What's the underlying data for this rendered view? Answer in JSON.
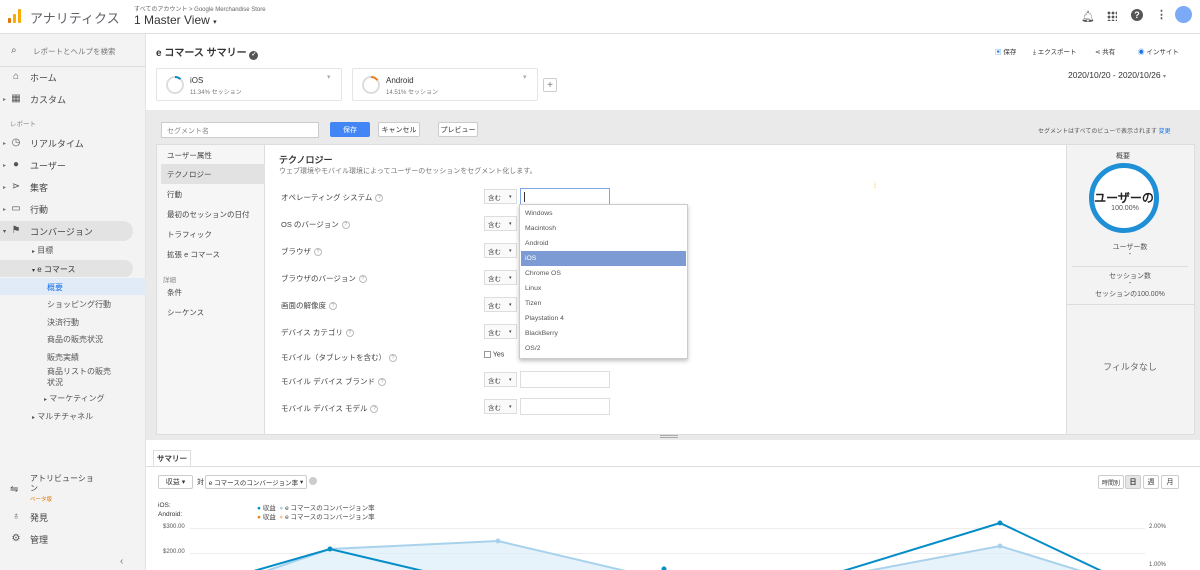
{
  "app": {
    "name": "アナリティクス",
    "breadcrumb": "すべてのアカウント > Google Merchandise Store",
    "view": "1 Master View"
  },
  "sidebar": {
    "search_placeholder": "レポートとヘルプを検索",
    "home": "ホーム",
    "custom": "カスタム",
    "reports_heading": "レポート",
    "realtime": "リアルタイム",
    "users": "ユーザー",
    "acquisition": "集客",
    "behavior": "行動",
    "conversions": "コンバージョン",
    "goals": "目標",
    "ecommerce": "e コマース",
    "overview": "概要",
    "shopping": "ショッピング行動",
    "checkout": "決済行動",
    "product_perf": "商品の販売状況",
    "sales_perf": "販売実績",
    "product_list_1": "商品リストの販売",
    "product_list_2": "状況",
    "marketing": "マーケティング",
    "multichannel": "マルチチャネル",
    "attribution_1": "アトリビューショ",
    "attribution_2": "ン",
    "beta": "ベータ版",
    "discover": "発見",
    "admin": "管理"
  },
  "page": {
    "title": "e コマース サマリー",
    "save": "保存",
    "export": "エクスポート",
    "share": "共有",
    "insights": "インサイト",
    "date_range": "2020/10/20 - 2020/10/26"
  },
  "segments": [
    {
      "name": "iOS",
      "sub": "11.34% セッション"
    },
    {
      "name": "Android",
      "sub": "14.51% セッション"
    }
  ],
  "editor": {
    "name_placeholder": "セグメント名",
    "save": "保存",
    "cancel": "キャンセル",
    "preview": "プレビュー",
    "visibility_note": "セグメントはすべてのビューで表示されます",
    "change": "変更",
    "nav": [
      "ユーザー属性",
      "テクノロジー",
      "行動",
      "最初のセッションの日付",
      "トラフィック",
      "拡張 e コマース"
    ],
    "advanced": "詳細",
    "nav_adv": [
      "条件",
      "シーケンス"
    ],
    "section_title": "テクノロジー",
    "section_desc": "ウェブ環境やモバイル環境によってユーザーのセッションをセグメント化します。",
    "fields": [
      "オペレーティング システム",
      "OS のバージョン",
      "ブラウザ",
      "ブラウザのバージョン",
      "画面の解像度",
      "デバイス カテゴリ",
      "モバイル（タブレットを含む）",
      "モバイル デバイス ブランド",
      "モバイル デバイス モデル"
    ],
    "op": "含む",
    "yes": "Yes",
    "dropdown": [
      "Windows",
      "Macintosh",
      "Android",
      "iOS",
      "Chrome OS",
      "Linux",
      "Tizen",
      "Playstation 4",
      "BlackBerry",
      "OS/2"
    ],
    "selected": "iOS",
    "summary_title": "概要",
    "summary_big": "ユーザーの",
    "summary_pct": "100.00%",
    "users_label": "ユーザー数",
    "users_val": "-",
    "sessions_label": "セッション数",
    "sessions_val": "-",
    "sessions_pct": "セッションの100.00%",
    "no_filter": "フィルタなし"
  },
  "chart": {
    "tab": "サマリー",
    "metric": "収益",
    "vs": "対",
    "metric2": "e コマースのコンバージョン率",
    "periods": [
      "時間別",
      "日",
      "週",
      "月"
    ],
    "legend_ios": "iOS:",
    "legend_android": "Android:",
    "l1": "収益",
    "l2": "e コマースのコンバージョン率",
    "y_left": [
      "$300.00",
      "$200.00"
    ],
    "y_right": [
      "2.00%",
      "1.00%"
    ]
  },
  "colors": {
    "accent": "#4285f4",
    "ios": "#058dc7",
    "ios_light": "#a8d2ec",
    "android": "#ed7e17",
    "selected": "#7c9bd4"
  }
}
